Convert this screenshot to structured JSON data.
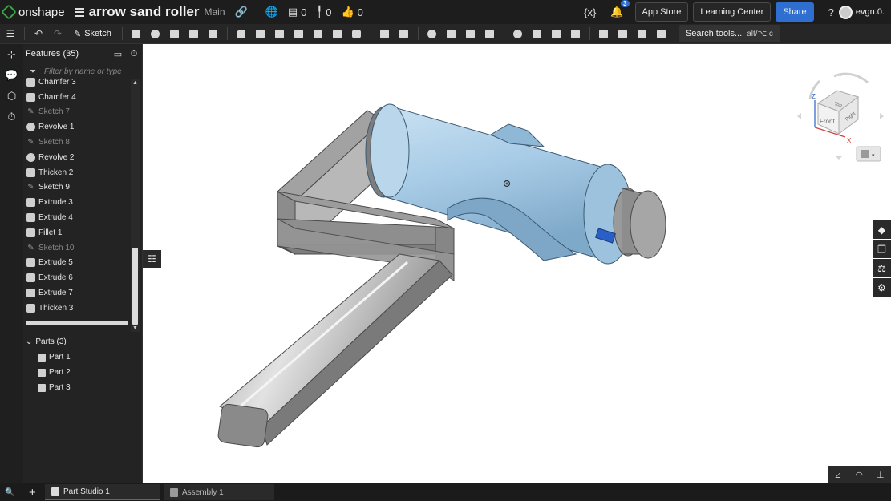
{
  "topbar": {
    "brand": "onshape",
    "doc_title": "arrow sand roller",
    "branch": "Main",
    "count_versions": "0",
    "count_tags": "0",
    "count_likes": "0",
    "notifications": "3",
    "app_store": "App Store",
    "learning_center": "Learning Center",
    "share": "Share",
    "user": "evgn.0."
  },
  "toolbar": {
    "sketch": "Sketch",
    "search_tools": "Search tools...",
    "search_shortcut": "alt/⌥ c"
  },
  "panel": {
    "features_title": "Features (35)",
    "filter_placeholder": "Filter by name or type",
    "features": [
      {
        "label": "Chamfer 3",
        "type": "solid",
        "dim": false
      },
      {
        "label": "Chamfer 4",
        "type": "solid",
        "dim": false
      },
      {
        "label": "Sketch 7",
        "type": "sketch",
        "dim": true
      },
      {
        "label": "Revolve 1",
        "type": "revolve",
        "dim": false
      },
      {
        "label": "Sketch 8",
        "type": "sketch",
        "dim": true
      },
      {
        "label": "Revolve 2",
        "type": "revolve",
        "dim": false
      },
      {
        "label": "Thicken 2",
        "type": "solid",
        "dim": false
      },
      {
        "label": "Sketch 9",
        "type": "sketch",
        "dim": false
      },
      {
        "label": "Extrude 3",
        "type": "solid",
        "dim": false
      },
      {
        "label": "Extrude 4",
        "type": "solid",
        "dim": false
      },
      {
        "label": "Fillet 1",
        "type": "solid",
        "dim": false
      },
      {
        "label": "Sketch 10",
        "type": "sketch",
        "dim": true
      },
      {
        "label": "Extrude 5",
        "type": "solid",
        "dim": false
      },
      {
        "label": "Extrude 6",
        "type": "solid",
        "dim": false
      },
      {
        "label": "Extrude 7",
        "type": "solid",
        "dim": false
      },
      {
        "label": "Thicken 3",
        "type": "solid",
        "dim": false
      }
    ],
    "parts_title": "Parts (3)",
    "parts": [
      "Part 1",
      "Part 2",
      "Part 3"
    ]
  },
  "viewcube": {
    "front": "Front",
    "top": "Top",
    "right": "Right",
    "axis_x": "X",
    "axis_z": "Z"
  },
  "tabs": {
    "part_studio": "Part Studio 1",
    "assembly": "Assembly 1"
  },
  "colors": {
    "accent": "#2f6fd1",
    "roller": "#a9cde6",
    "frame": "#8d8d8d"
  }
}
